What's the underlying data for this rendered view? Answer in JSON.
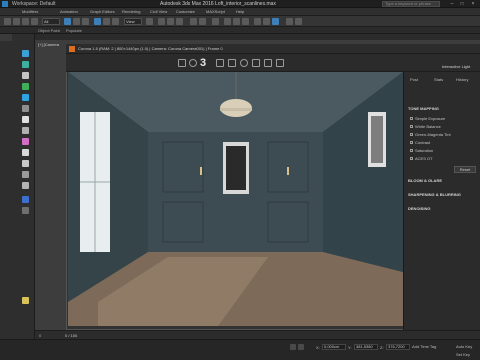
{
  "titlebar": {
    "workspace": "Workspace: Default",
    "title": "Autodesk 3ds Max 2016    Loft_interior_scanlines.max",
    "search_placeholder": "Type a keyword or phrase"
  },
  "menu": {
    "items": [
      "Modifiers",
      "Animation",
      "Graph Editors",
      "Rendering",
      "Civil View",
      "Customize",
      "MAXScript",
      "Help"
    ]
  },
  "toolbar": {
    "selection_filter": "All",
    "view_dropdown": "View"
  },
  "ribbon": {
    "items": [
      "Object Paint",
      "Populate"
    ]
  },
  "viewport": {
    "label": "[+] [Camera"
  },
  "vfb": {
    "title": "Corona 1.5 (RAM: 2 | 800×1440px (1.0) | Camera: Corona Camera001) | Frame 0",
    "frame_counter": "3"
  },
  "render_panel": {
    "header": "Interactive Light",
    "tabs": [
      "Post",
      "Stats",
      "History"
    ],
    "tone_mapping": "TONE MAPPING",
    "tone_items": [
      "Simple Exposure",
      "White Balance",
      "Green-Magenta Tint",
      "Contrast",
      "Saturation",
      "ACES OT"
    ],
    "reset": "Reset",
    "sections": [
      "BLOOM & GLARE",
      "SHARPENING & BLURRING",
      "DENOISING"
    ]
  },
  "timeline": {
    "start": "0",
    "end": "0 / 100"
  },
  "status": {
    "x_label": "X:",
    "x_value": "0,000cm",
    "y_label": "Y:",
    "y_value": "381,5380",
    "z_label": "Z:",
    "z_value": "376,7200",
    "autokey": "Auto Key",
    "setkey": "Set Key",
    "selected": "Selected",
    "key_filters": "Key Filters...",
    "add_time_tag": "Add Time Tag"
  },
  "colors": {
    "accent": "#3d7fb8",
    "corona_orange": "#d96f1f",
    "wall": "#3a4a4f",
    "floor": "#8a7460"
  }
}
